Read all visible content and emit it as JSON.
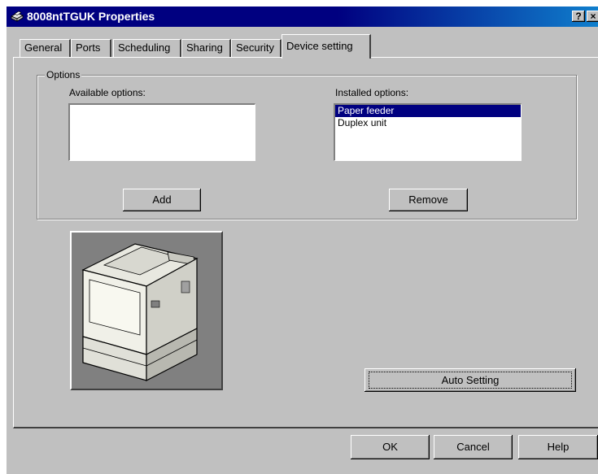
{
  "window": {
    "title": "8008ntTGUK Properties",
    "help_btn": "?",
    "close_btn": "×"
  },
  "tabs": [
    {
      "label": "General"
    },
    {
      "label": "Ports"
    },
    {
      "label": "Scheduling"
    },
    {
      "label": "Sharing"
    },
    {
      "label": "Security"
    },
    {
      "label": "Device setting",
      "active": true
    }
  ],
  "options": {
    "group_label": "Options",
    "available_label": "Available options:",
    "installed_label": "Installed options:",
    "available_items": [],
    "installed_items": [
      {
        "label": "Paper feeder",
        "selected": true
      },
      {
        "label": "Duplex unit",
        "selected": false
      }
    ],
    "add_label": "Add",
    "remove_label": "Remove"
  },
  "auto_setting_label": "Auto Setting",
  "footer": {
    "ok_label": "OK",
    "cancel_label": "Cancel",
    "help_label": "Help"
  },
  "colors": {
    "title_bar": "#000080",
    "face": "#c0c0c0",
    "selection": "#000080"
  },
  "icons": {
    "title": "printer-icon",
    "image": "printer-illustration"
  }
}
